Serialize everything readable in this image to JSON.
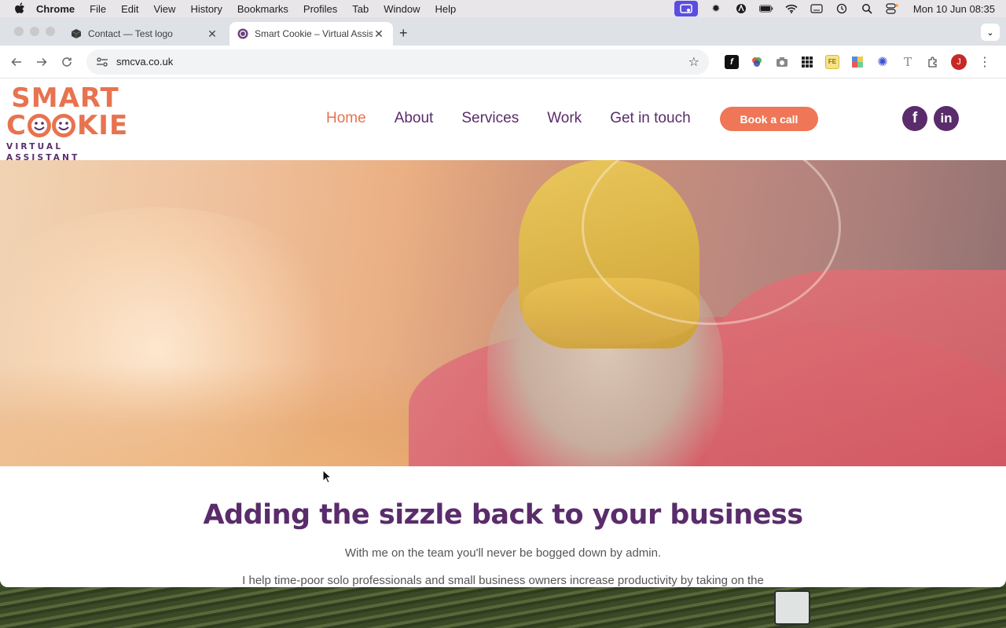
{
  "menubar": {
    "app": "Chrome",
    "items": [
      "File",
      "Edit",
      "View",
      "History",
      "Bookmarks",
      "Profiles",
      "Tab",
      "Window",
      "Help"
    ],
    "clock": "Mon 10 Jun  08:35"
  },
  "tabs": [
    {
      "title": "Contact — Test logo"
    },
    {
      "title": "Smart Cookie – Virtual Assistant"
    }
  ],
  "toolbar": {
    "url": "smcva.co.uk",
    "profile_initial": "J"
  },
  "site": {
    "logo": {
      "line1": "SMART",
      "line2a": "C",
      "line2b": "KIE",
      "tagline": "VIRTUAL ASSISTANT"
    },
    "nav": [
      "Home",
      "About",
      "Services",
      "Work",
      "Get in touch"
    ],
    "book_button": "Book a call",
    "headline": "Adding the sizzle back to your business",
    "subheadline": "With me on the team you'll never be bogged down by admin.",
    "body": "I help time-poor solo professionals and small business owners increase productivity by taking on the"
  },
  "colors": {
    "brand_orange": "#e8734f",
    "brand_purple": "#5a2c6b",
    "button": "#ef7656"
  }
}
